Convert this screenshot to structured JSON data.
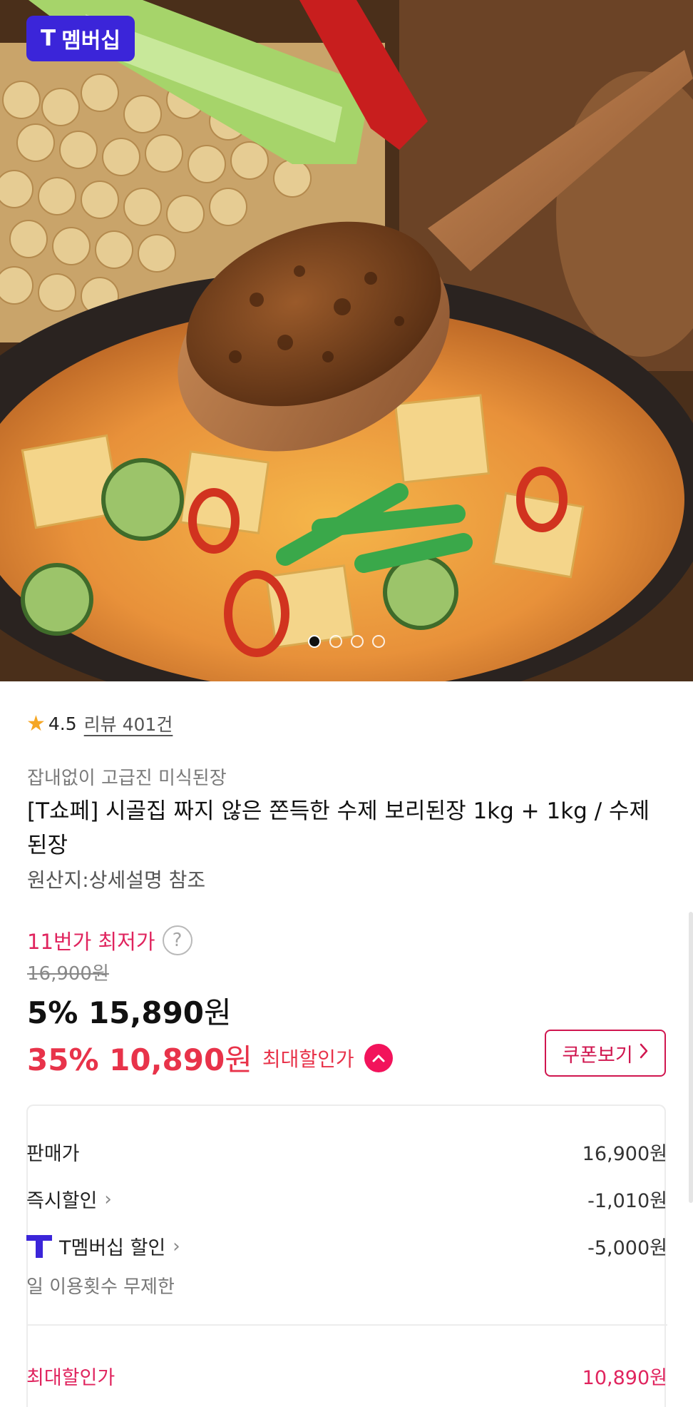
{
  "hero": {
    "badge_label": "멤버십",
    "badge_logo": "T",
    "carousel": {
      "count": 4,
      "active_index": 0
    }
  },
  "product": {
    "rating": "4.5",
    "review_link": "리뷰 401건",
    "subtitle": "잡내없이 고급진 미식된장",
    "title": "[T쇼페] 시골집 짜지 않은 쫀득한 수제 보리된장 1kg + 1kg / 수제 된장",
    "origin": "원산지:상세설명 참조"
  },
  "pricing": {
    "lowest_label": "11번가 최저가",
    "help_icon": "?",
    "original_price": "16,900원",
    "discount1_rate": "5%",
    "discount1_price": "15,890",
    "discount2_rate": "35%",
    "discount2_price": "10,890",
    "currency": "원",
    "max_label": "최대할인가",
    "coupon_button": "쿠폰보기"
  },
  "breakdown": {
    "rows": [
      {
        "label": "판매가",
        "value": "16,900원"
      },
      {
        "label": "즉시할인",
        "value": "-1,010원"
      },
      {
        "label": "T멤버십 할인",
        "value": "-5,000원"
      }
    ],
    "note": "일 이용횟수 무제한",
    "final_label": "최대할인가",
    "final_value": "10,890원"
  },
  "colors": {
    "brand_purple": "#3b25d9",
    "accent_red": "#e8334a",
    "accent_pink": "#e0245e",
    "star": "#f5a623"
  }
}
